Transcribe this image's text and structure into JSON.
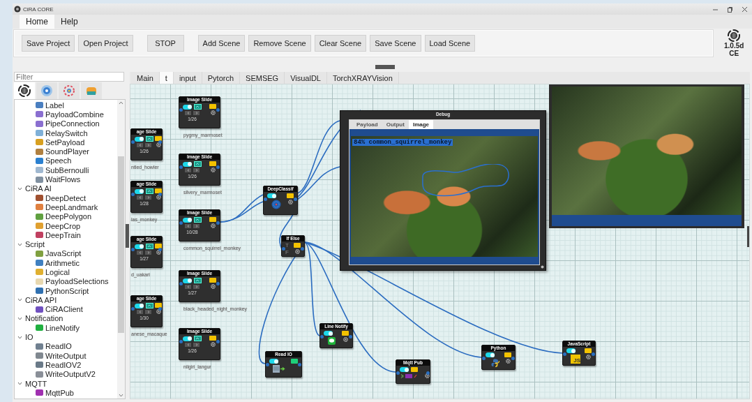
{
  "window": {
    "title": "CiRA CORE"
  },
  "menu_tabs": [
    {
      "label": "Home",
      "selected": true
    },
    {
      "label": "Help",
      "selected": false
    }
  ],
  "toolbar": {
    "button_groups": [
      [
        "Save Project",
        "Open Project"
      ],
      [
        "STOP"
      ],
      [
        "Add Scene",
        "Remove Scene",
        "Clear Scene",
        "Save Scene",
        "Load Scene"
      ]
    ]
  },
  "version": {
    "number": "1.0.5d",
    "edition": "CE"
  },
  "sidebar": {
    "filter": {
      "placeholder": "Filter"
    },
    "icon_tabs": [
      {
        "selected": true
      },
      {
        "selected": false
      },
      {
        "selected": false
      },
      {
        "selected": false
      }
    ],
    "tree": [
      {
        "label": "Label",
        "color": "#4a7fc0"
      },
      {
        "label": "PayloadCombine",
        "color": "#8a6fd0"
      },
      {
        "label": "PipeConnection",
        "color": "#8a6fd0"
      },
      {
        "label": "RelaySwitch",
        "color": "#7fb0d8"
      },
      {
        "label": "SetPayload",
        "color": "#d8a020"
      },
      {
        "label": "SoundPlayer",
        "color": "#b08040"
      },
      {
        "label": "Speech",
        "color": "#2a80d0"
      },
      {
        "label": "SubBernoulli",
        "color": "#a0b8d0"
      },
      {
        "label": "WaitFlows",
        "color": "#8090a0"
      },
      {
        "label": "CiRA AI",
        "expanded": true,
        "children": [
          {
            "label": "DeepDetect",
            "color": "#a05030"
          },
          {
            "label": "DeepLandmark",
            "color": "#e08040"
          },
          {
            "label": "DeepPolygon",
            "color": "#60a040"
          },
          {
            "label": "DeepCrop",
            "color": "#e0a030"
          },
          {
            "label": "DeepTrain",
            "color": "#c04060"
          }
        ]
      },
      {
        "label": "Script",
        "expanded": true,
        "children": [
          {
            "label": "JavaScript",
            "color": "#80a040"
          },
          {
            "label": "Arithmetic",
            "color": "#4080c0"
          },
          {
            "label": "Logical",
            "color": "#e0b030"
          },
          {
            "label": "PayloadSelections",
            "color": "#e8d8b0"
          },
          {
            "label": "PythonScript",
            "color": "#3070b0"
          }
        ]
      },
      {
        "label": "CiRA API",
        "expanded": true,
        "children": [
          {
            "label": "CiRAClient",
            "color": "#7050c0"
          }
        ]
      },
      {
        "label": "Notification",
        "expanded": true,
        "children": [
          {
            "label": "LineNotify",
            "color": "#20b040"
          }
        ]
      },
      {
        "label": "IO",
        "expanded": true,
        "children": [
          {
            "label": "ReadIO",
            "color": "#708090"
          },
          {
            "label": "WriteOutput",
            "color": "#808890"
          },
          {
            "label": "ReadIOV2",
            "color": "#6a7a88"
          },
          {
            "label": "WriteOutputV2",
            "color": "#8a8f98"
          }
        ]
      },
      {
        "label": "MQTT",
        "expanded": true,
        "children": [
          {
            "label": "MqttPub",
            "color": "#a030b0"
          }
        ]
      }
    ]
  },
  "canvas": {
    "tabs": [
      {
        "label": "Main",
        "selected": false
      },
      {
        "label": "t",
        "selected": true
      },
      {
        "label": "input",
        "selected": false
      },
      {
        "label": "Pytorch",
        "selected": false
      },
      {
        "label": "SEMSEG",
        "selected": false
      },
      {
        "label": "VisualDL",
        "selected": false
      },
      {
        "label": "TorchXRAYVision",
        "selected": false
      }
    ],
    "nodes": [
      {
        "kind": "image-slide",
        "title": "Image Slide",
        "on": true,
        "counter": "1/26",
        "caption": "pygmy_marmoset"
      },
      {
        "kind": "image-slide",
        "title": "Image Slide",
        "on": true,
        "counter": "1/26",
        "caption": "silvery_marmoset"
      },
      {
        "kind": "image-slide",
        "title": "Image Slide",
        "on": true,
        "counter": "10/28",
        "caption": "common_squirrel_monkey"
      },
      {
        "kind": "image-slide",
        "title": "Image Slide",
        "on": true,
        "counter": "1/27",
        "caption": "black_headed_night_monkey"
      },
      {
        "kind": "image-slide",
        "title": "Image Slide",
        "on": true,
        "counter": "1/26",
        "caption": "nilgiri_langur"
      },
      {
        "kind": "image-slide",
        "title": "age Slide",
        "on": true,
        "counter": "1/26",
        "caption": "ntled_howler"
      },
      {
        "kind": "image-slide",
        "title": "age Slide",
        "on": true,
        "counter": "1/28",
        "caption": "las_monkey"
      },
      {
        "kind": "image-slide",
        "title": "age Slide",
        "on": true,
        "counter": "1/27",
        "caption": "d_uakari"
      },
      {
        "kind": "image-slide",
        "title": "age Slide",
        "on": true,
        "counter": "1/30",
        "caption": "anese_macaque"
      },
      {
        "kind": "deep-classif",
        "title": "DeepClassif",
        "on": true
      },
      {
        "kind": "if-else",
        "title": "If Else",
        "true_label": "T",
        "false_label": "F"
      },
      {
        "kind": "line-notify",
        "title": "Line Notify",
        "on": true
      },
      {
        "kind": "read-io",
        "title": "Read IO",
        "on": true
      },
      {
        "kind": "mqtt-pub",
        "title": "Mqtt Pub",
        "on": true
      },
      {
        "kind": "python",
        "title": "Python",
        "on": true
      },
      {
        "kind": "javascript",
        "title": "JavaScript",
        "on": true,
        "icon_text": "JS"
      }
    ],
    "debug_window": {
      "title": "Debug",
      "tabs": [
        {
          "label": "Payload",
          "selected": false
        },
        {
          "label": "Output",
          "selected": false
        },
        {
          "label": "Image",
          "selected": true
        }
      ],
      "detection_label": "84% common_squirrel_monkey"
    }
  }
}
